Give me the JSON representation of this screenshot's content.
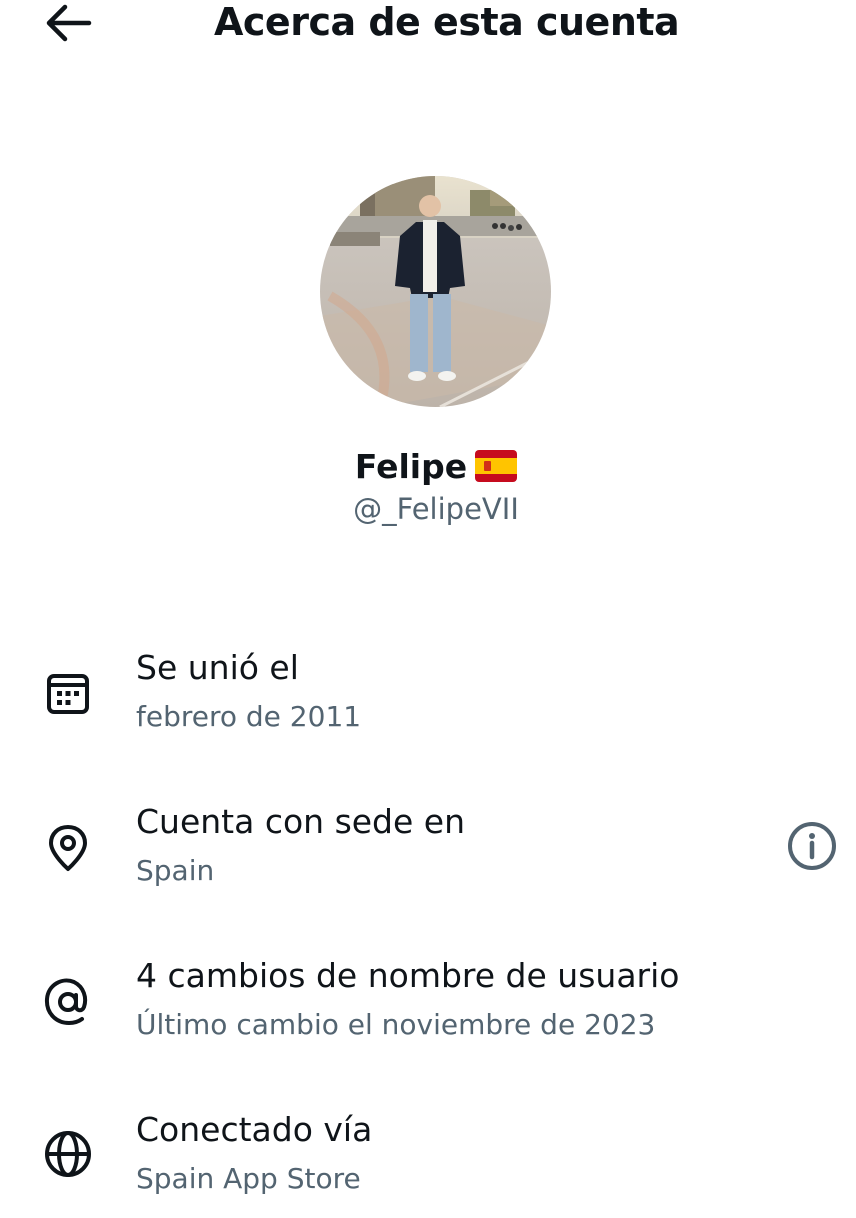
{
  "header": {
    "back_icon": "arrow-left-icon",
    "title": "Acerca de esta cuenta"
  },
  "profile": {
    "name": "Felipe",
    "flag": "🇪🇸",
    "handle": "@_FelipeVII"
  },
  "details": [
    {
      "icon": "calendar-icon",
      "label": "Se unió el",
      "value": "febrero de 2011"
    },
    {
      "icon": "location-pin-icon",
      "label": "Cuenta con sede en",
      "value": "Spain",
      "action_icon": "info-icon"
    },
    {
      "icon": "at-sign-icon",
      "label": "4 cambios de nombre de usuario",
      "value": "Último cambio el noviembre de 2023"
    },
    {
      "icon": "globe-icon",
      "label": "Conectado vía",
      "value": "Spain App Store"
    }
  ],
  "colors": {
    "primary_text": "#0f1419",
    "secondary_text": "#536471",
    "background": "#ffffff"
  }
}
